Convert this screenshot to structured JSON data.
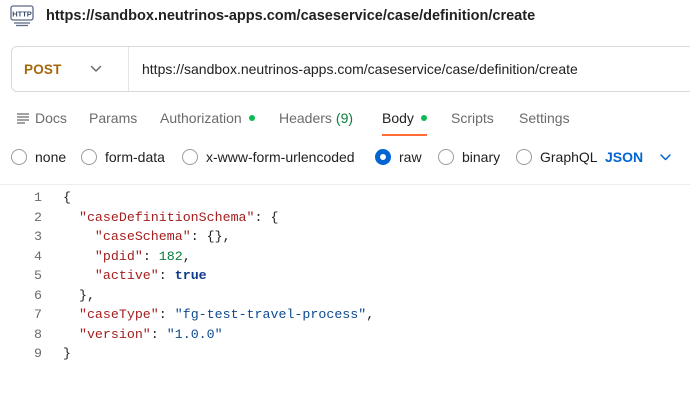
{
  "request_title": "https://sandbox.neutrinos-apps.com/caseservice/case/definition/create",
  "title_icon": "http-icon",
  "method": "POST",
  "url": "https://sandbox.neutrinos-apps.com/caseservice/case/definition/create",
  "tabs": [
    {
      "label": "Docs",
      "icon": "docs-icon"
    },
    {
      "label": "Params"
    },
    {
      "label": "Authorization",
      "status_dot": true
    },
    {
      "label": "Headers",
      "count": "(9)"
    },
    {
      "label": "Body",
      "status_dot": true,
      "active": true
    },
    {
      "label": "Scripts"
    },
    {
      "label": "Settings"
    }
  ],
  "body_types": [
    {
      "label": "none",
      "selected": false
    },
    {
      "label": "form-data",
      "selected": false
    },
    {
      "label": "x-www-form-urlencoded",
      "selected": false
    },
    {
      "label": "raw",
      "selected": true
    },
    {
      "label": "binary",
      "selected": false
    },
    {
      "label": "GraphQL",
      "selected": false
    }
  ],
  "raw_language": "JSON",
  "editor": {
    "line_numbers": [
      "1",
      "2",
      "3",
      "4",
      "5",
      "6",
      "7",
      "8",
      "9"
    ],
    "code": {
      "open_brace": "{",
      "key_caseDefinitionSchema": "\"caseDefinitionSchema\"",
      "key_caseSchema": "\"caseSchema\"",
      "val_caseSchema": "{}",
      "key_pdid": "\"pdid\"",
      "val_pdid": "182",
      "key_active": "\"active\"",
      "val_active": "true",
      "close_inner": "},",
      "key_caseType": "\"caseType\"",
      "val_caseType": "\"fg-test-travel-process\"",
      "key_version": "\"version\"",
      "val_version": "\"1.0.0\"",
      "close_brace": "}"
    }
  },
  "colors": {
    "method": "#a6660b",
    "active_tab_underline": "#ff6c37",
    "status_dot": "#0cbb52",
    "accent": "#0265d2",
    "json_key": "#a51d1d",
    "json_string": "#0d4a91",
    "json_number": "#0a7d3c"
  }
}
